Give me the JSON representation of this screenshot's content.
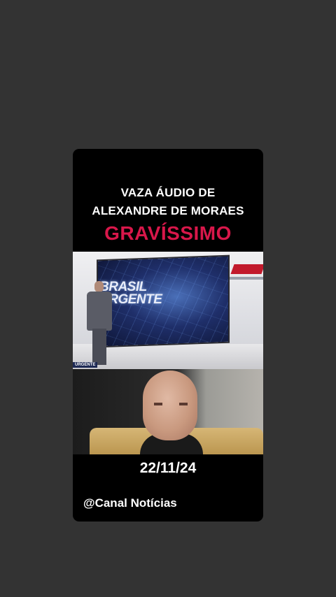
{
  "post": {
    "headline_line1": "VAZA ÁUDIO DE",
    "headline_line2": "ALEXANDRE DE MORAES",
    "alert_text": "GRAVÍSSIMO",
    "studio_logo_line1": "BRASIL",
    "studio_logo_line2": "URGENTE",
    "studio_bug": "URGENTE",
    "date": "22/11/24",
    "channel_handle": "@Canal Notícias"
  },
  "colors": {
    "page_background": "#333333",
    "card_background": "#000000",
    "alert": "#d8174a",
    "text": "#ffffff"
  }
}
